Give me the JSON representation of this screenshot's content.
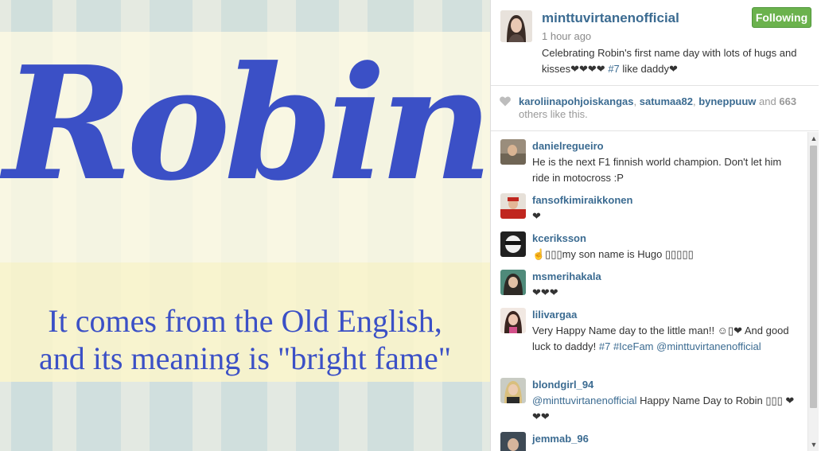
{
  "post": {
    "image": {
      "headline": "Robin",
      "meaning_line1": "It comes from the Old English,",
      "meaning_line2": "and its meaning is \"bright fame\""
    },
    "owner": "minttuvirtanenofficial",
    "follow_label": "Following",
    "time": "1 hour ago",
    "caption_text": "Celebrating Robin's first name day with lots of hugs and kisses❤❤❤❤",
    "caption_hashtag": "#7",
    "caption_tail": "like daddy❤"
  },
  "likes": {
    "likers": [
      "karoliinapohjoiskangas",
      "satumaa82",
      "byneppuuw"
    ],
    "and_label": "and",
    "count": "663",
    "suffix": "others like this."
  },
  "comments": [
    {
      "user": "danielregueiro",
      "text": "He is the next F1 finnish world champion. Don't let him ride in motocross :P"
    },
    {
      "user": "fansofkimiraikkonen",
      "text": "❤"
    },
    {
      "user": "kceriksson",
      "text": "☝▯▯▯my son name is Hugo ▯▯▯▯▯"
    },
    {
      "user": "msmerihakala",
      "text": "❤❤❤"
    },
    {
      "user": "lilivargaa",
      "text_before": "Very Happy Name day to the little man!! ☺▯❤ And good luck to daddy!",
      "tag1": "#7",
      "tag2": "#IceFam",
      "mention": "@minttuvirtanenofficial"
    },
    {
      "user": "blondgirl_94",
      "mention": "@minttuvirtanenofficial",
      "text_after": "Happy Name Day to Robin ▯▯▯ ❤❤❤"
    },
    {
      "user": "jemmab_96",
      "text": ""
    }
  ],
  "colors": {
    "link": "#3b6b91",
    "follow_green": "#6bb24d",
    "image_text_blue": "#3b50c6"
  },
  "icons": {
    "heart": "heart-icon",
    "scroll_up": "scroll-up-arrow-icon",
    "scroll_down": "scroll-down-arrow-icon"
  }
}
